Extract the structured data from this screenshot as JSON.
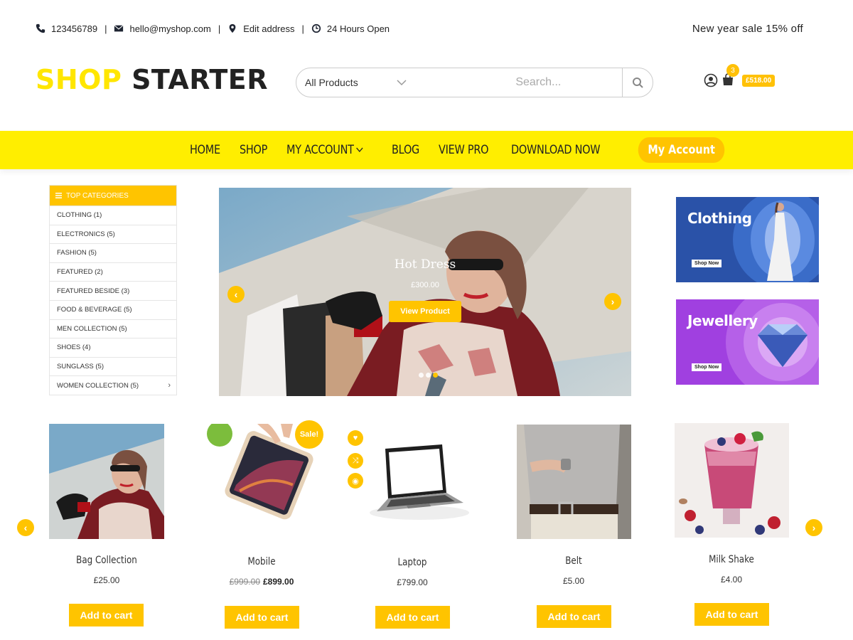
{
  "topbar": {
    "phone": "123456789",
    "email": "hello@myshop.com",
    "address": "Edit address",
    "hours": "24 Hours Open",
    "promo": "New year sale 15% off"
  },
  "header": {
    "logo_part1": "SHOP",
    "logo_part2": "STARTER",
    "search_category": "All Products",
    "search_placeholder": "Search...",
    "cart_count": "3",
    "cart_total": "£518.00"
  },
  "nav": {
    "items": [
      "HOME",
      "SHOP",
      "MY ACCOUNT",
      "BLOG",
      "VIEW PRO",
      "DOWNLOAD NOW"
    ],
    "cta": "My Account"
  },
  "categories": {
    "heading": "TOP CATEGORIES",
    "items": [
      "CLOTHING (1)",
      "ELECTRONICS (5)",
      "FASHION (5)",
      "FEATURED (2)",
      "FEATURED BESIDE (3)",
      "FOOD & BEVERAGE (5)",
      "MEN COLLECTION (5)",
      "SHOES (4)",
      "SUNGLASS (5)",
      "WOMEN COLLECTION (5)"
    ]
  },
  "hero": {
    "title": "Hot Dress",
    "price": "£300.00",
    "button": "View Product"
  },
  "banners": [
    {
      "title": "Clothing",
      "button": "Shop Now"
    },
    {
      "title": "Jewellery",
      "button": "Shop Now"
    }
  ],
  "products": [
    {
      "name": "Bag Collection",
      "price": "£25.00",
      "button": "Add to cart"
    },
    {
      "name": "Mobile",
      "old_price": "£999.00",
      "price": "£899.00",
      "badge": "Sale!",
      "button": "Add to cart"
    },
    {
      "name": "Laptop",
      "price": "£799.00",
      "button": "Add to cart"
    },
    {
      "name": "Belt",
      "price": "£5.00",
      "button": "Add to cart"
    },
    {
      "name": "Milk Shake",
      "price": "£4.00",
      "button": "Add to cart"
    }
  ],
  "colors": {
    "brand_yellow": "#ffee00",
    "accent": "#ffc400"
  }
}
